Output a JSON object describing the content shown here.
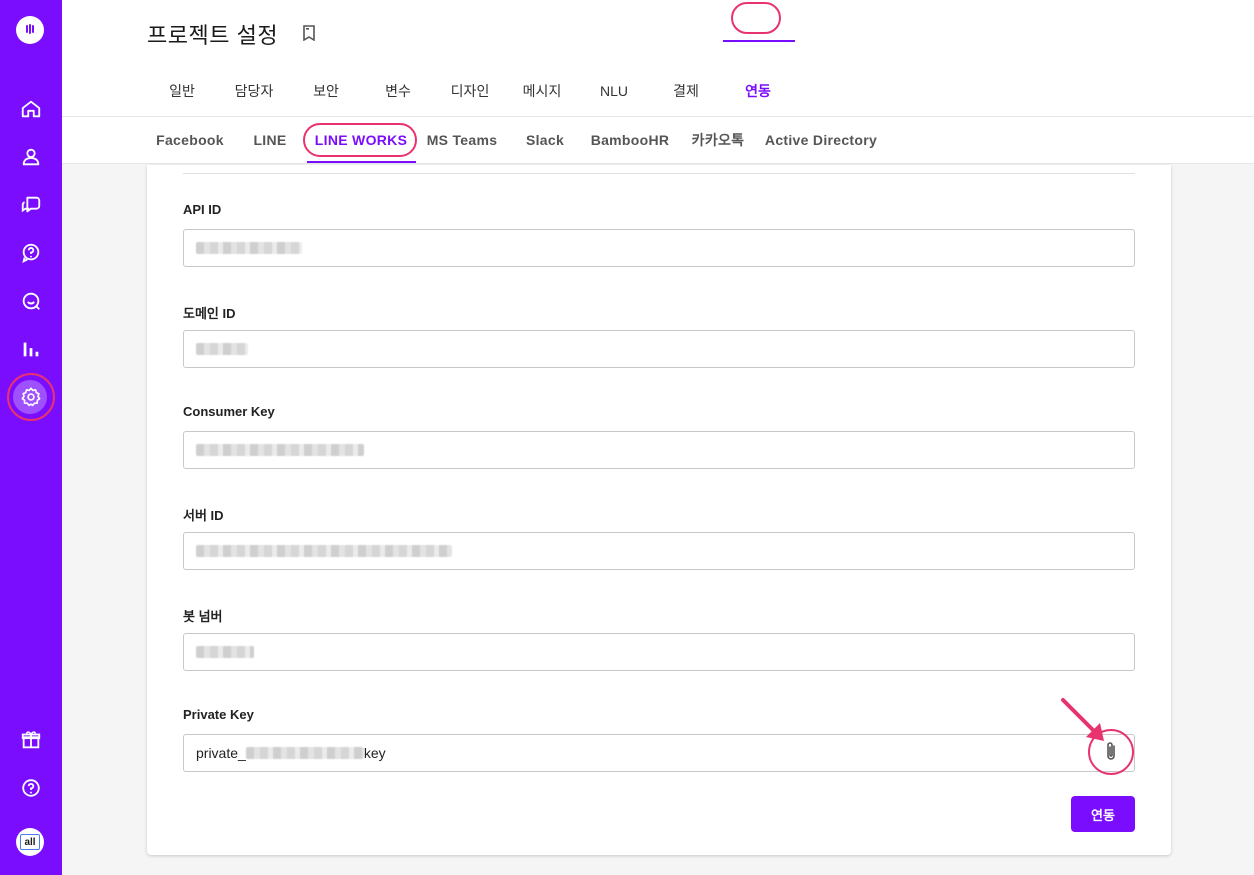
{
  "header": {
    "title": "프로젝트 설정",
    "tabs": [
      {
        "label": "일반"
      },
      {
        "label": "담당자"
      },
      {
        "label": "보안"
      },
      {
        "label": "변수"
      },
      {
        "label": "디자인"
      },
      {
        "label": "메시지"
      },
      {
        "label": "NLU"
      },
      {
        "label": "결제"
      },
      {
        "label": "연동"
      }
    ],
    "active_tab": "연동"
  },
  "subtabs": {
    "items": [
      {
        "label": "Facebook"
      },
      {
        "label": "LINE"
      },
      {
        "label": "LINE WORKS"
      },
      {
        "label": "MS Teams"
      },
      {
        "label": "Slack"
      },
      {
        "label": "BambooHR"
      },
      {
        "label": "카카오톡"
      },
      {
        "label": "Active Directory"
      }
    ],
    "active": "LINE WORKS"
  },
  "form": {
    "api_id": {
      "label": "API ID"
    },
    "domain_id": {
      "label": "도메인 ID"
    },
    "consumer_key": {
      "label": "Consumer Key"
    },
    "server_id": {
      "label": "서버 ID"
    },
    "bot_number": {
      "label": "봇 넘버"
    },
    "private_key": {
      "label": "Private Key",
      "value_prefix": "private_",
      "value_suffix": "key"
    },
    "submit_label": "연동"
  },
  "sidebar": {
    "items": [
      {
        "icon": "home-icon"
      },
      {
        "icon": "user-icon"
      },
      {
        "icon": "chat-bubbles-icon"
      },
      {
        "icon": "question-bubble-icon"
      },
      {
        "icon": "chat-smile-icon"
      },
      {
        "icon": "bar-chart-icon"
      },
      {
        "icon": "gear-icon",
        "active": true
      },
      {
        "icon": "gift-icon"
      },
      {
        "icon": "help-icon"
      }
    ],
    "avatar_text": "all"
  },
  "colors": {
    "brand": "#7b0dff",
    "highlight": "#e8336f"
  }
}
